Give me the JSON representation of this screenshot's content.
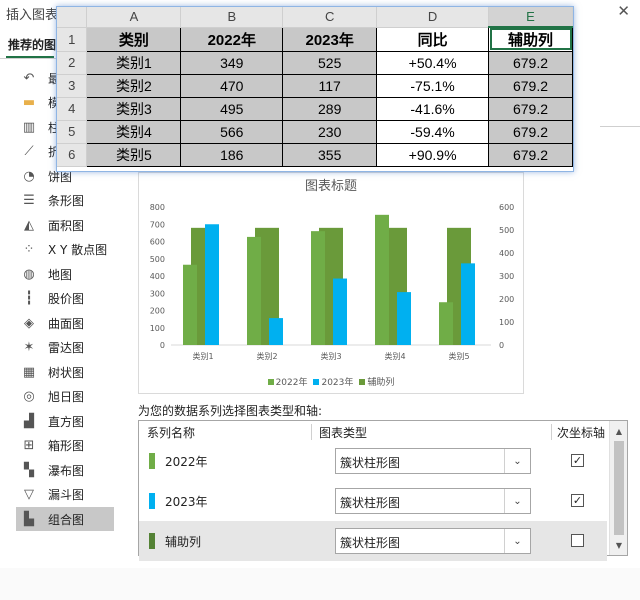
{
  "dialog": {
    "title": "插入图表",
    "close": "✕",
    "tab_recommended": "推荐的图",
    "side_items": [
      {
        "label": "最",
        "icon": "recent-icon"
      },
      {
        "label": "模",
        "icon": "template-folder-icon"
      },
      {
        "label": "柱",
        "icon": "column-chart-icon"
      },
      {
        "label": "折",
        "icon": "line-chart-icon"
      },
      {
        "label": "饼图",
        "icon": "pie-chart-icon"
      },
      {
        "label": "条形图",
        "icon": "bar-chart-icon"
      },
      {
        "label": "面积图",
        "icon": "area-chart-icon"
      },
      {
        "label": "X Y 散点图",
        "icon": "scatter-chart-icon"
      },
      {
        "label": "地图",
        "icon": "map-chart-icon"
      },
      {
        "label": "股价图",
        "icon": "stock-chart-icon"
      },
      {
        "label": "曲面图",
        "icon": "surface-chart-icon"
      },
      {
        "label": "雷达图",
        "icon": "radar-chart-icon"
      },
      {
        "label": "树状图",
        "icon": "treemap-chart-icon"
      },
      {
        "label": "旭日图",
        "icon": "sunburst-chart-icon"
      },
      {
        "label": "直方图",
        "icon": "histogram-chart-icon"
      },
      {
        "label": "箱形图",
        "icon": "box-whisker-chart-icon"
      },
      {
        "label": "瀑布图",
        "icon": "waterfall-chart-icon"
      },
      {
        "label": "漏斗图",
        "icon": "funnel-chart-icon"
      },
      {
        "label": "组合图",
        "icon": "combo-chart-icon",
        "active": true
      }
    ],
    "series_prompt": "为您的数据系列选择图表类型和轴:",
    "table_headers": {
      "name": "系列名称",
      "type": "图表类型",
      "axis": "次坐标轴"
    },
    "series_rows": [
      {
        "name": "2022年",
        "color": "#70AD47",
        "type": "簇状柱形图",
        "secondary": true,
        "selected": false
      },
      {
        "name": "2023年",
        "color": "#00B0F0",
        "type": "簇状柱形图",
        "secondary": true,
        "selected": false
      },
      {
        "name": "辅助列",
        "color": "#548235",
        "type": "簇状柱形图",
        "secondary": false,
        "selected": true
      }
    ]
  },
  "spreadsheet": {
    "columns": [
      "A",
      "B",
      "C",
      "D",
      "E"
    ],
    "rows": [
      "1",
      "2",
      "3",
      "4",
      "5",
      "6"
    ],
    "header": [
      "类别",
      "2022年",
      "2023年",
      "同比",
      "辅助列"
    ],
    "data": [
      [
        "类别1",
        "349",
        "525",
        "+50.4%",
        "679.2"
      ],
      [
        "类别2",
        "470",
        "117",
        "-75.1%",
        "679.2"
      ],
      [
        "类别3",
        "495",
        "289",
        "-41.6%",
        "679.2"
      ],
      [
        "类别4",
        "566",
        "230",
        "-59.4%",
        "679.2"
      ],
      [
        "类别5",
        "186",
        "355",
        "+90.9%",
        "679.2"
      ]
    ]
  },
  "chart_data": {
    "type": "bar",
    "title": "图表标题",
    "categories": [
      "类别1",
      "类别2",
      "类别3",
      "类别4",
      "类别5"
    ],
    "series": [
      {
        "name": "2022年",
        "values": [
          349,
          470,
          495,
          566,
          186
        ],
        "color": "#70AD47",
        "axis": "secondary"
      },
      {
        "name": "2023年",
        "values": [
          525,
          117,
          289,
          230,
          355
        ],
        "color": "#00B0F0",
        "axis": "secondary"
      },
      {
        "name": "辅助列",
        "values": [
          679.2,
          679.2,
          679.2,
          679.2,
          679.2
        ],
        "color": "#6A9A3A",
        "axis": "primary"
      }
    ],
    "left_axis": {
      "ylim": [
        0,
        800
      ],
      "ticks": [
        "0",
        "100",
        "200",
        "300",
        "400",
        "500",
        "600",
        "700",
        "800"
      ]
    },
    "right_axis": {
      "ylim": [
        0,
        600
      ],
      "ticks": [
        "0",
        "100",
        "200",
        "300",
        "400",
        "500",
        "600"
      ]
    },
    "legend_position": "bottom",
    "grid": false
  }
}
